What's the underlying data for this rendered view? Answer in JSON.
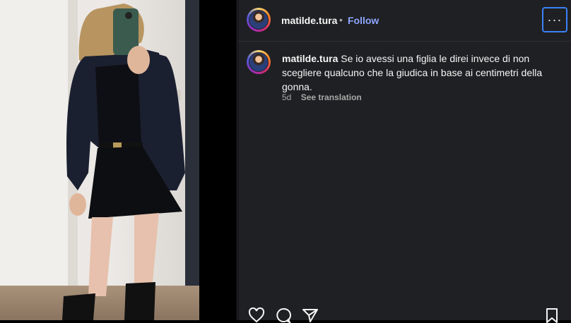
{
  "post": {
    "username": "matilde.tura",
    "separator": "•",
    "follow_label": "Follow",
    "more_label": "···",
    "caption_text": "Se io avessi una figlia le direi invece di non scegliere qualcuno che la giudica in base ai centimetri della gonna.",
    "time_ago": "5d",
    "see_translation_label": "See translation",
    "icons": [
      "heart-icon",
      "comment-icon",
      "share-icon",
      "bookmark-icon",
      "more-icon"
    ]
  },
  "colors": {
    "panel_bg": "#1f2023",
    "follow_blue": "#8ea6ff",
    "focus_ring": "#3b82f6"
  }
}
